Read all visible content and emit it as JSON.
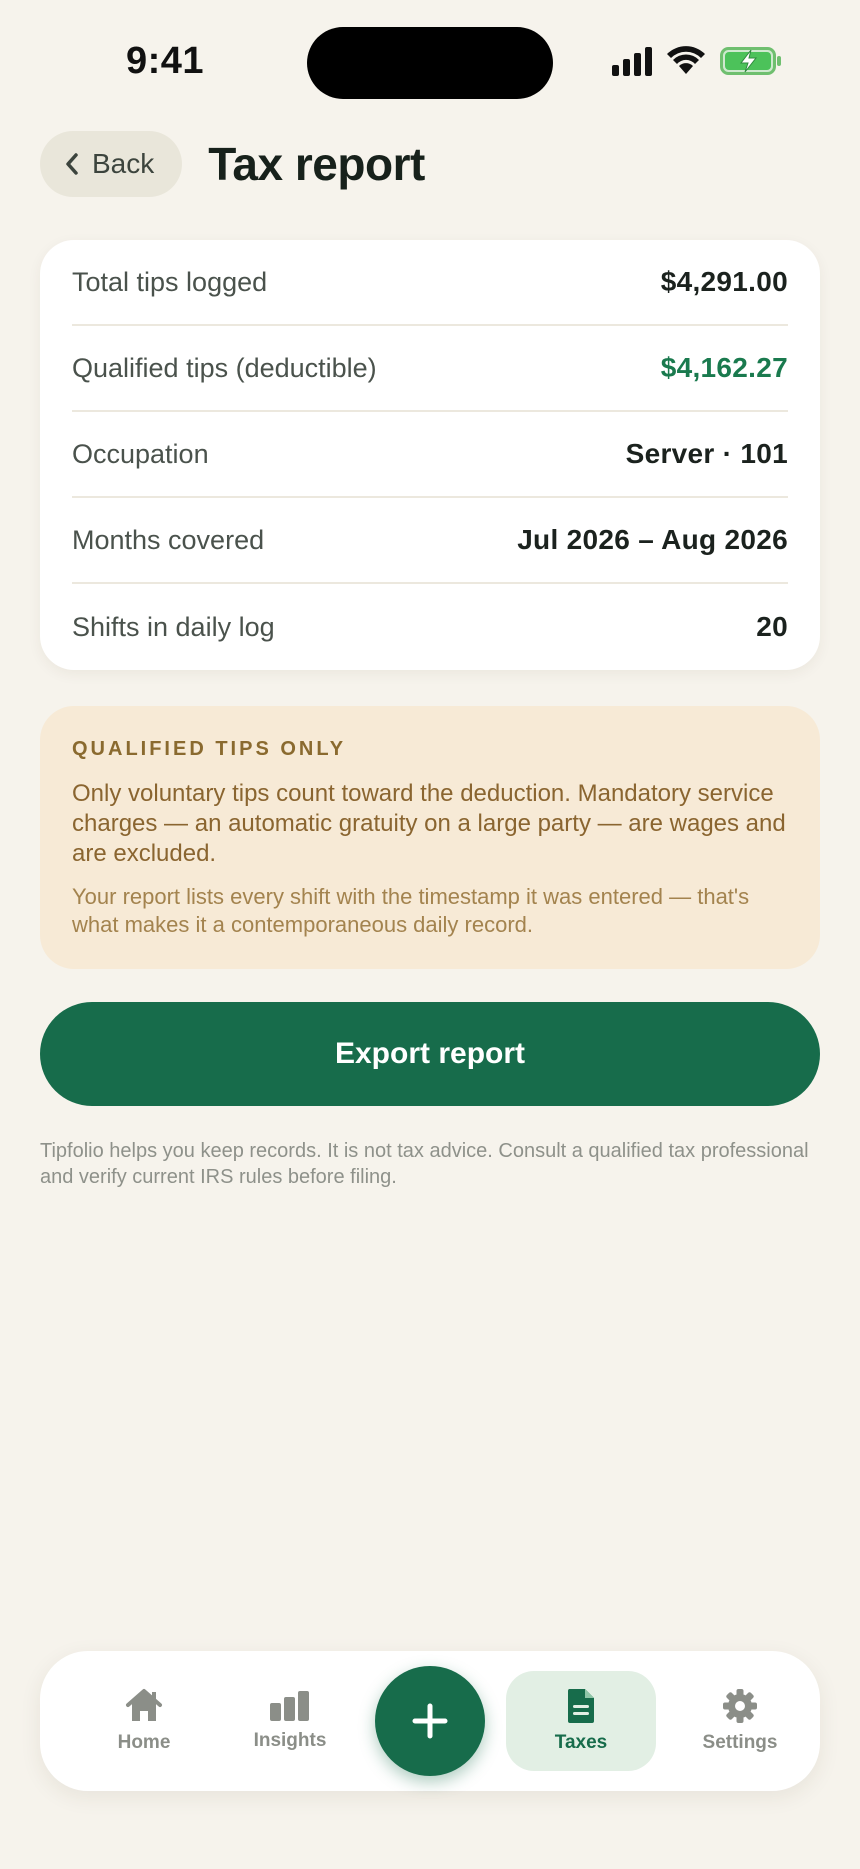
{
  "status_bar": {
    "time": "9:41",
    "icons": [
      "cellular-signal-icon",
      "wifi-icon",
      "battery-charging-icon"
    ]
  },
  "header": {
    "back_label": "Back",
    "title": "Tax report"
  },
  "summary": {
    "rows": [
      {
        "label": "Total tips logged",
        "value": "$4,291.00"
      },
      {
        "label": "Qualified tips (deductible)",
        "value": "$4,162.27"
      },
      {
        "label": "Occupation",
        "value": "Server · 101"
      },
      {
        "label": "Months covered",
        "value": "Jul 2026 – Aug 2026"
      },
      {
        "label": "Shifts in daily log",
        "value": "20"
      }
    ]
  },
  "notice": {
    "title": "QUALIFIED TIPS ONLY",
    "body": "Only voluntary tips count toward the deduction. Mandatory service charges — an automatic gratuity on a large party — are wages and are excluded.",
    "sub": "Your report lists every shift with the timestamp it was entered — that's what makes it a contemporaneous daily record."
  },
  "export_label": "Export report",
  "disclaimer": "Tipfolio helps you keep records. It is not tax advice. Consult a qualified tax professional and verify current IRS rules before filing.",
  "tab_bar": {
    "tabs": [
      {
        "label": "Home",
        "icon": "home-icon"
      },
      {
        "label": "Insights",
        "icon": "bar-chart-icon"
      },
      {
        "label": "Taxes",
        "icon": "document-icon",
        "active": true
      },
      {
        "label": "Settings",
        "icon": "gear-icon"
      }
    ],
    "add_icon": "plus-icon"
  },
  "colors": {
    "background": "#f6f3ec",
    "brand_green": "#176c4b",
    "accent_green_text": "#1a7a4e",
    "notice_bg": "#f7ead6",
    "notice_text": "#8a6530",
    "active_tab_bg": "#e2efe4"
  }
}
